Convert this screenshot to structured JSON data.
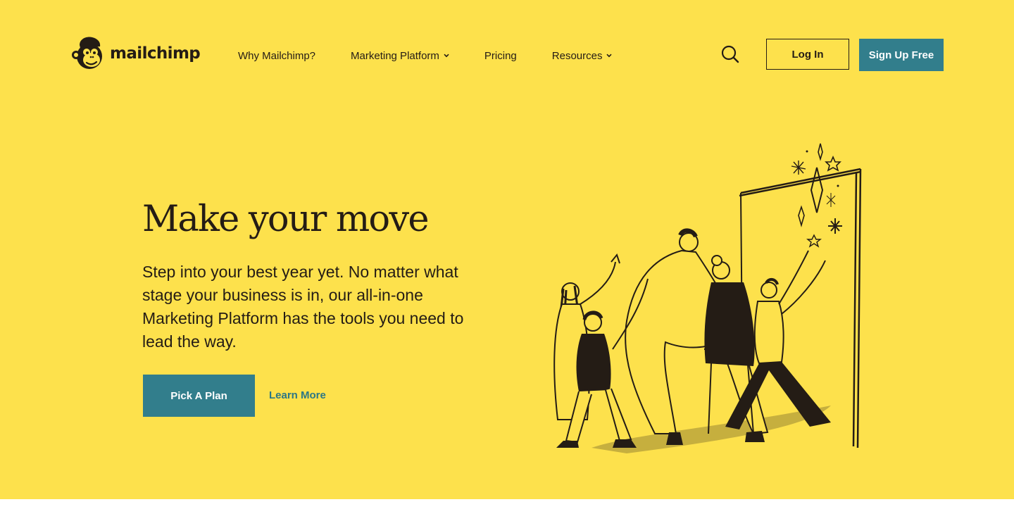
{
  "header": {
    "logo_text": "mailchimp",
    "logo_icon": "freddie-chimp-icon",
    "nav": [
      {
        "label": "Why Mailchimp?",
        "has_dropdown": false
      },
      {
        "label": "Marketing Platform",
        "has_dropdown": true
      },
      {
        "label": "Pricing",
        "has_dropdown": false
      },
      {
        "label": "Resources",
        "has_dropdown": true
      }
    ],
    "search_icon": "search-icon",
    "login_label": "Log In",
    "signup_label": "Sign Up Free"
  },
  "hero": {
    "headline": "Make your move",
    "subcopy": "Step into your best year yet. No matter what stage your business is in, our all-in-one Marketing Platform has the tools you need to lead the way.",
    "primary_cta": "Pick A Plan",
    "secondary_cta": "Learn More",
    "illustration": "people-walking-through-doorway-illustration"
  },
  "colors": {
    "background_yellow": "#fde14c",
    "accent_teal": "#327e8c",
    "text_dark": "#241c15"
  }
}
